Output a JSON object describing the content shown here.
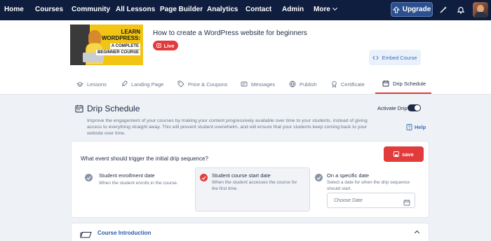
{
  "nav": {
    "items": [
      "Home",
      "Courses",
      "Community",
      "All Lessons",
      "Page Builder",
      "Analytics",
      "Contact",
      "Admin",
      "More"
    ],
    "upgrade_label": "Upgrade",
    "icons": [
      "wand-icon",
      "bell-icon",
      "user-avatar"
    ]
  },
  "course": {
    "title": "How to create a WordPress website for beginners",
    "status": "Live",
    "embed_label": "Embed Course",
    "thumbnail_text": [
      "LEARN",
      "WORDPRESS:",
      "A COMPLETE",
      "BEGINNER COURSE"
    ]
  },
  "tabs": [
    {
      "label": "Lessons",
      "icon": "graduation-cap-icon"
    },
    {
      "label": "Landing Page",
      "icon": "rocket-icon"
    },
    {
      "label": "Price & Coupons",
      "icon": "tag-icon"
    },
    {
      "label": "Messages",
      "icon": "message-icon"
    },
    {
      "label": "Publish",
      "icon": "globe-icon"
    },
    {
      "label": "Certificate",
      "icon": "award-icon"
    },
    {
      "label": "Drip Schedule",
      "icon": "calendar-icon",
      "active": true
    }
  ],
  "drip": {
    "title": "Drip Schedule",
    "activate_label": "Activate Drip",
    "activate_on": true,
    "description": "Improve the engagement of your courses by making your content progressively available over time to your students, instead of giving access to everything straight away. This will prevent student overwhelm, and will ensure that your students keep coming back to your website over time.",
    "help_label": "Help",
    "question": "What event should trigger the initial drip sequence?",
    "save_label": "save",
    "options": [
      {
        "title": "Student enrollment date",
        "desc": "When the student enrolls in the course.",
        "selected": false
      },
      {
        "title": "Student course start date",
        "desc": "When the student accesses the course for the first time.",
        "selected": true
      },
      {
        "title": "On a specific date",
        "desc": "Select a date for when the drip sequence should start.",
        "selected": false
      }
    ],
    "date_placeholder": "Choose Date"
  },
  "section": {
    "title": "Course Introduction"
  },
  "colors": {
    "nav_bg": "#0f1d3f",
    "accent_red": "#e23b3b",
    "link_blue": "#2a5bb0"
  }
}
